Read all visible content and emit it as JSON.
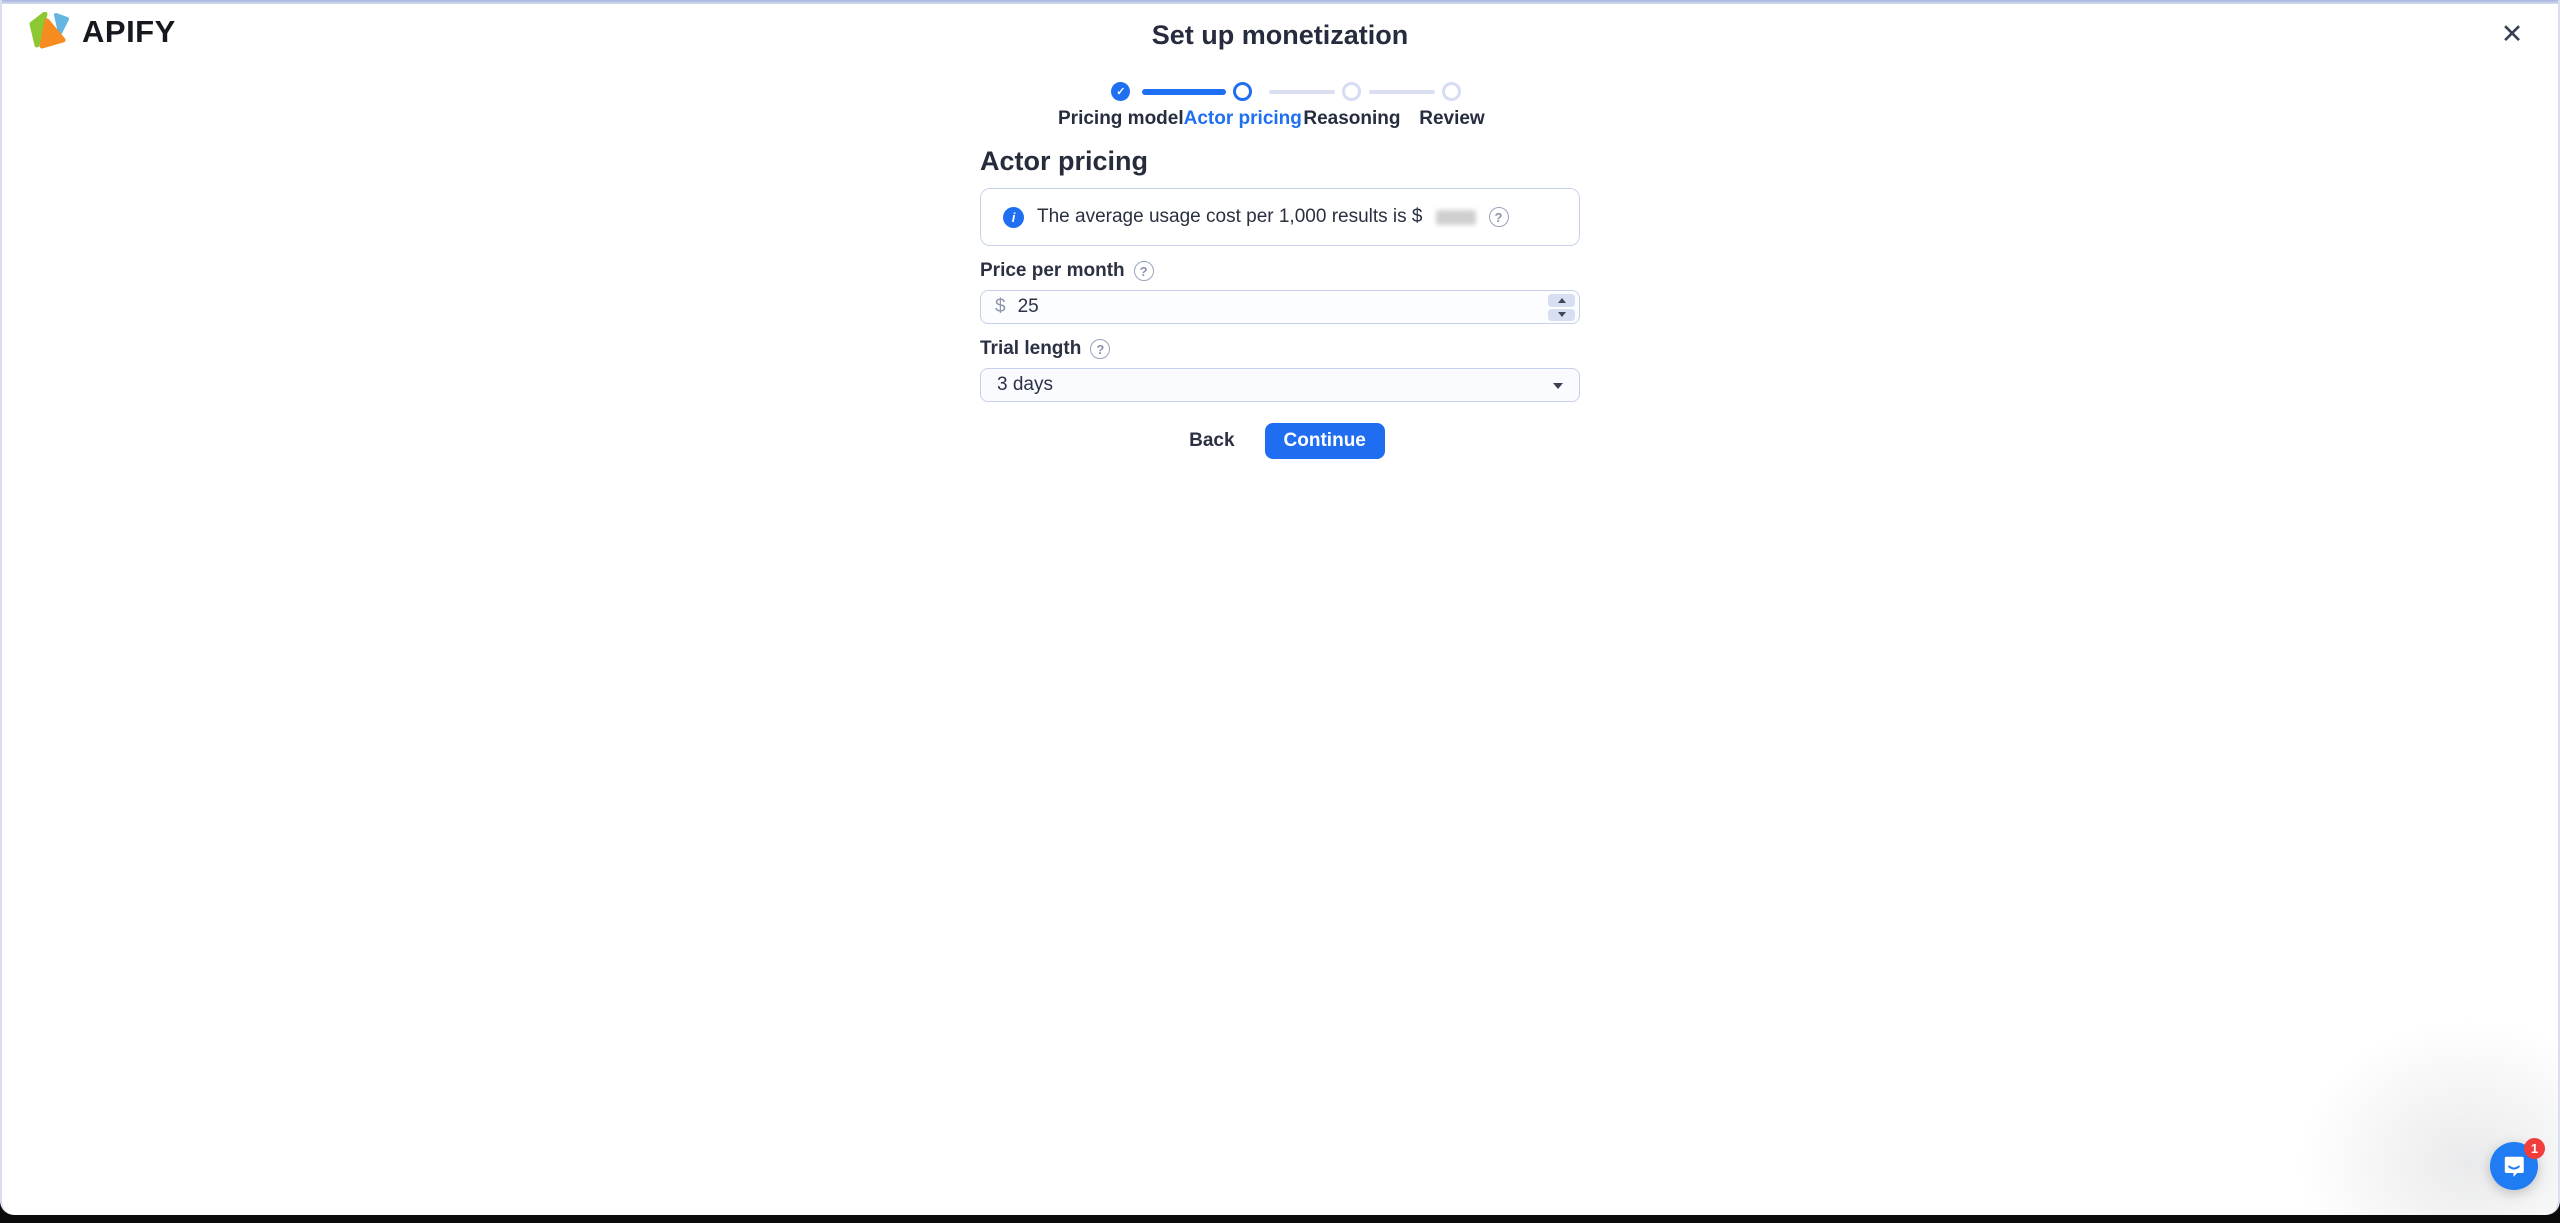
{
  "page": {
    "brand": "APIFY",
    "title": "Set up monetization"
  },
  "icons": {
    "close": "✕",
    "check": "✓",
    "info": "i",
    "help": "?"
  },
  "stepper": {
    "steps": [
      {
        "label": "Pricing model",
        "state": "completed"
      },
      {
        "label": "Actor pricing",
        "state": "active"
      },
      {
        "label": "Reasoning",
        "state": "upcoming"
      },
      {
        "label": "Review",
        "state": "upcoming"
      }
    ]
  },
  "form": {
    "heading": "Actor pricing",
    "info_banner": {
      "text": "The average usage cost per 1,000 results is $",
      "value_redacted": true
    },
    "price_field": {
      "label": "Price per month",
      "currency": "$",
      "value": "25"
    },
    "trial_field": {
      "label": "Trial length",
      "value": "3 days"
    },
    "back_label": "Back",
    "continue_label": "Continue"
  },
  "chat": {
    "unread_count": "1"
  },
  "colors": {
    "accent_blue": "#1e6ff2",
    "inactive_step": "#d6dcf2",
    "border_light": "#c7d0ea",
    "text_dark": "#262c3d",
    "badge_red": "#f23d3d",
    "chat_blue": "#1f7cf3",
    "logo_green": "#8bc832",
    "logo_orange": "#f68b1f",
    "logo_blue": "#64b5e2"
  }
}
